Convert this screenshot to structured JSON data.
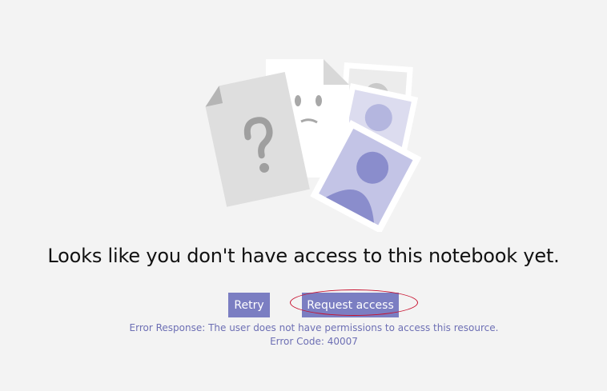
{
  "message": {
    "headline": "Looks like you don't have access to this notebook yet."
  },
  "actions": {
    "retry_label": "Retry",
    "request_access_label": "Request access"
  },
  "error": {
    "response": "Error Response: The user does not have permissions to access this resource.",
    "code": "Error Code: 40007"
  },
  "colors": {
    "background": "#f3f3f3",
    "button": "#7b7ec2",
    "error_text": "#6d6fb4",
    "highlight": "#c8102e"
  },
  "icons": {
    "illustration": "no-access-documents-illustration"
  }
}
